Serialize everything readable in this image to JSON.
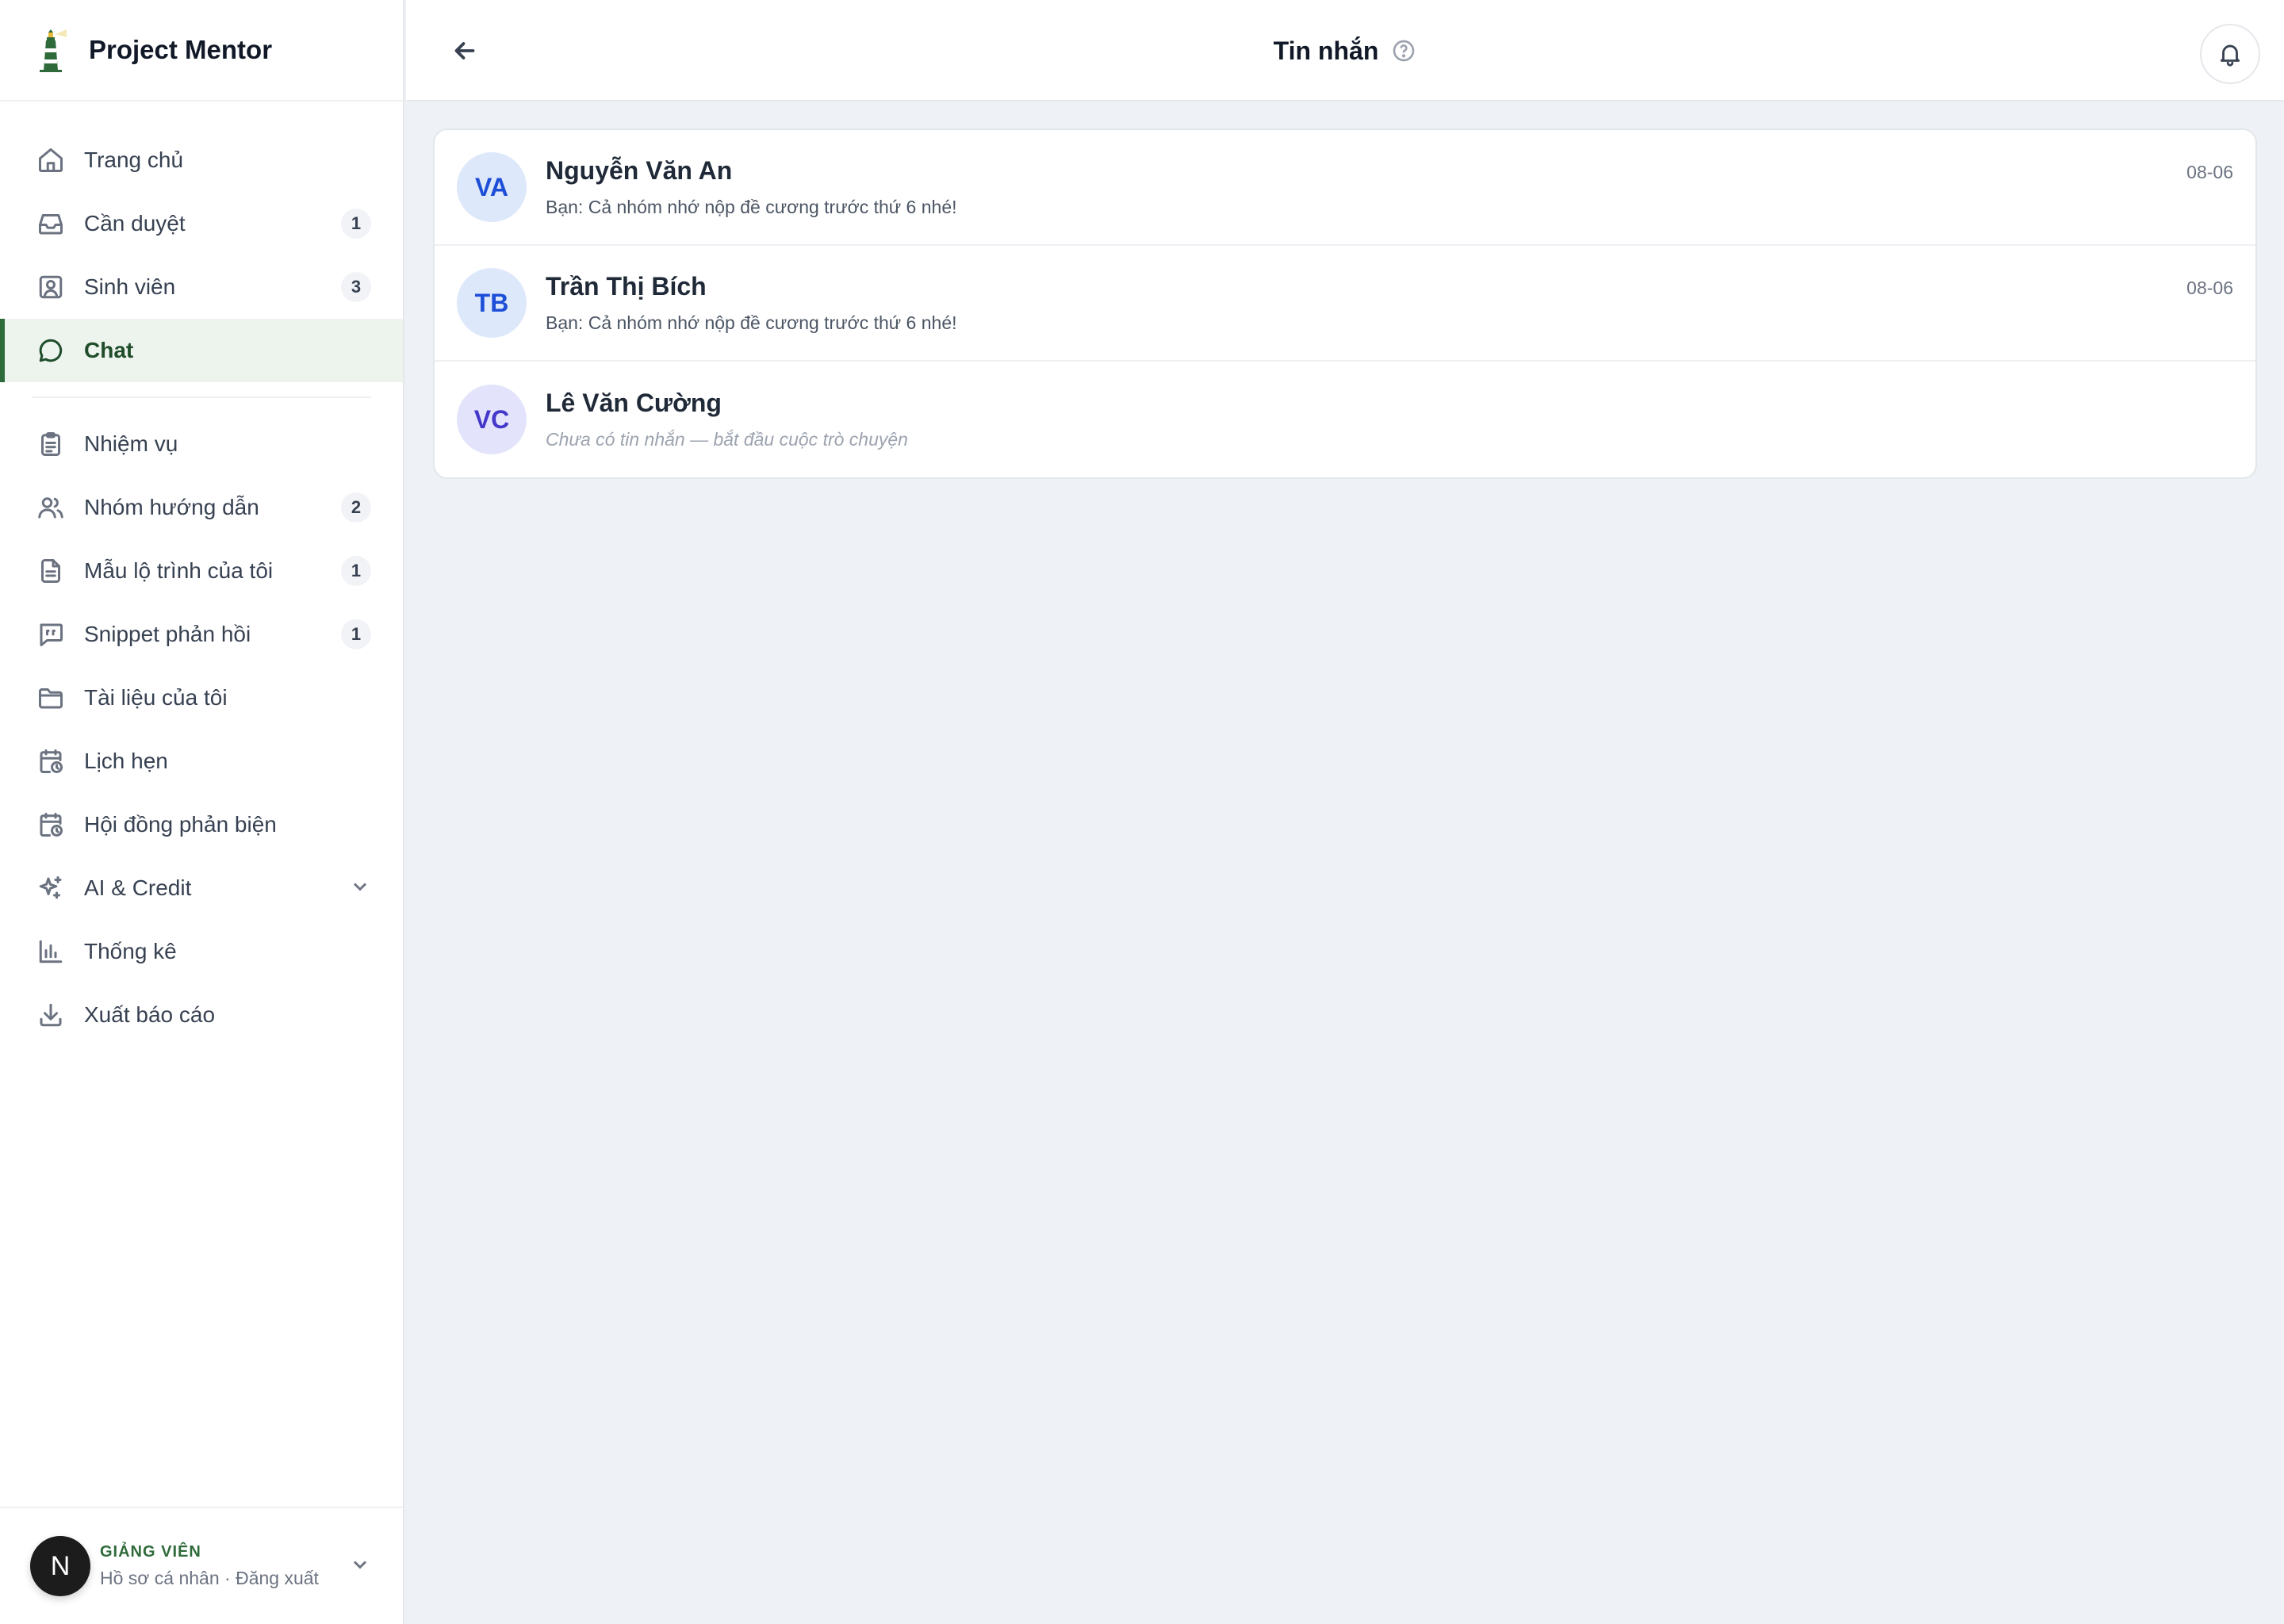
{
  "brand": {
    "name": "Project Mentor"
  },
  "sidebar": {
    "items": [
      {
        "label": "Trang chủ",
        "icon": "home-icon",
        "badge": ""
      },
      {
        "label": "Cần duyệt",
        "icon": "inbox-icon",
        "badge": "1"
      },
      {
        "label": "Sinh viên",
        "icon": "user-square-icon",
        "badge": "3"
      },
      {
        "label": "Chat",
        "icon": "chat-bubble-icon",
        "badge": "",
        "active": true
      }
    ],
    "items2": [
      {
        "label": "Nhiệm vụ",
        "icon": "clipboard-icon",
        "badge": ""
      },
      {
        "label": "Nhóm hướng dẫn",
        "icon": "users-icon",
        "badge": "2"
      },
      {
        "label": "Mẫu lộ trình của tôi",
        "icon": "file-text-icon",
        "badge": "1"
      },
      {
        "label": "Snippet phản hồi",
        "icon": "message-quote-icon",
        "badge": "1"
      },
      {
        "label": "Tài liệu của tôi",
        "icon": "folder-icon",
        "badge": ""
      },
      {
        "label": "Lịch hẹn",
        "icon": "calendar-clock-icon",
        "badge": ""
      },
      {
        "label": "Hội đồng phản biện",
        "icon": "calendar-clock-icon",
        "badge": ""
      },
      {
        "label": "AI & Credit",
        "icon": "sparkles-icon",
        "badge": ""
      },
      {
        "label": "Thống kê",
        "icon": "bar-chart-icon",
        "badge": ""
      },
      {
        "label": "Xuất báo cáo",
        "icon": "download-icon",
        "badge": ""
      }
    ]
  },
  "user": {
    "initial": "N",
    "role": "GIẢNG VIÊN",
    "profile_link": "Hồ sơ cá nhân",
    "separator": " · ",
    "logout_link": "Đăng xuất"
  },
  "header": {
    "title": "Tin nhắn"
  },
  "conversations": [
    {
      "initials": "VA",
      "name": "Nguyễn Văn An",
      "preview": "Bạn: Cả nhóm nhớ nộp đề cương trước thứ 6 nhé!",
      "date": "08-06"
    },
    {
      "initials": "TB",
      "name": "Trần Thị Bích",
      "preview": "Bạn: Cả nhóm nhớ nộp đề cương trước thứ 6 nhé!",
      "date": "08-06"
    },
    {
      "initials": "VC",
      "name": "Lê Văn Cường",
      "preview": "Chưa có tin nhắn — bắt đầu cuộc trò chuyện",
      "date": ""
    }
  ],
  "colors": {
    "accent": "#2f6b3a",
    "active_bg": "#edf4ee",
    "avatar_blue": "#dde8fb",
    "avatar_violet": "#e3e4fb"
  }
}
